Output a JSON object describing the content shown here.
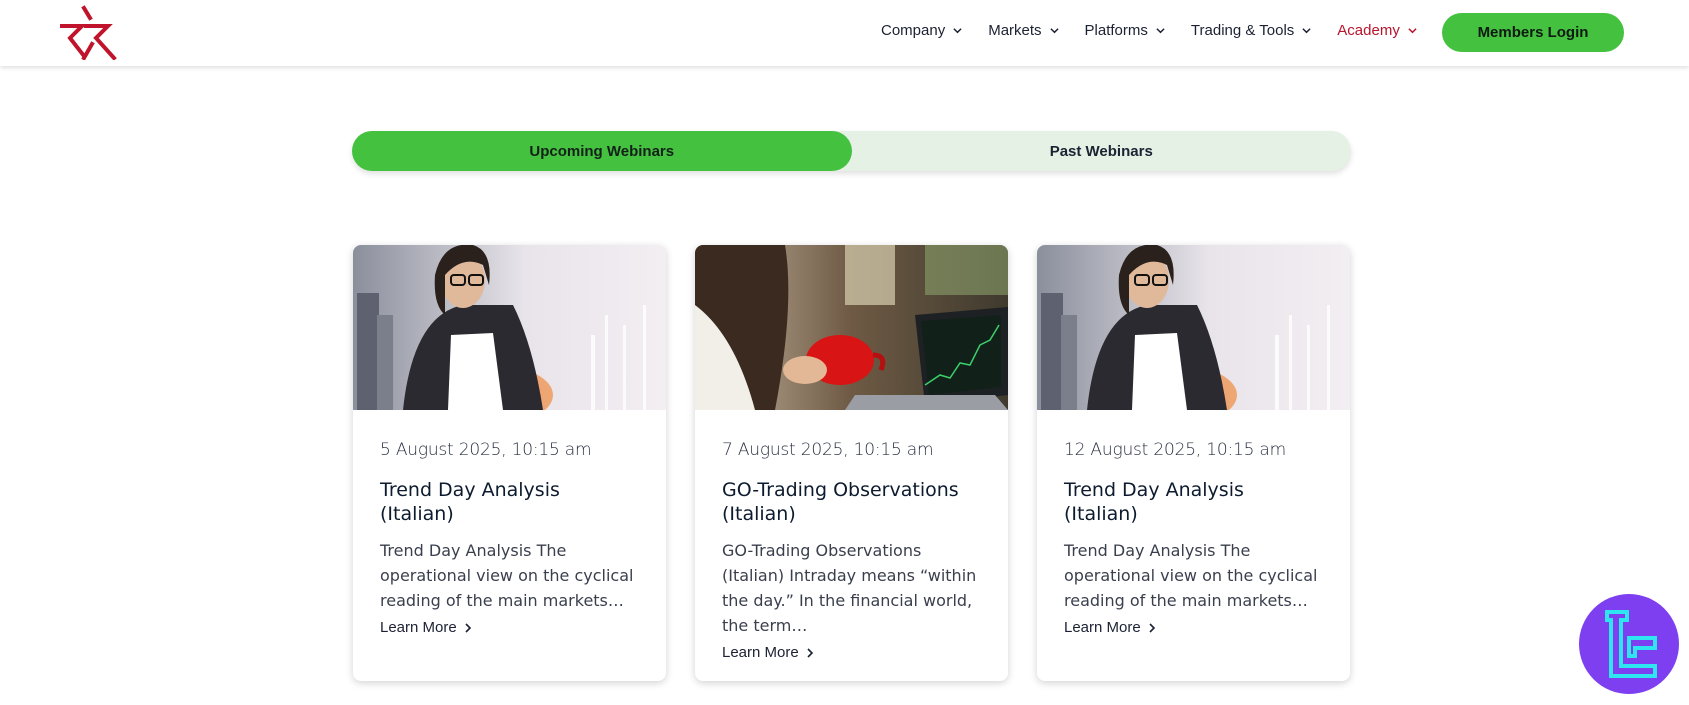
{
  "header": {
    "nav": [
      {
        "label": "Company"
      },
      {
        "label": "Markets"
      },
      {
        "label": "Platforms"
      },
      {
        "label": "Trading & Tools"
      },
      {
        "label": "Academy",
        "active": true
      }
    ],
    "login_label": "Members Login",
    "accent_red": "#b8142c"
  },
  "tabs": [
    {
      "label": "Upcoming Webinars",
      "active": true
    },
    {
      "label": "Past Webinars",
      "active": false
    }
  ],
  "colors": {
    "brand_green": "#44c13f",
    "tab_bg": "#e5f1e4",
    "badge_purple": "#7d3ff0"
  },
  "cards": [
    {
      "image": "woman-with-glasses-city-chart-photo",
      "date": "5 August 2025, 10:15 am",
      "title": "Trend Day Analysis (Italian)",
      "description": "Trend Day Analysis The operational view on the cyclical reading of the main markets…",
      "link": "Learn More"
    },
    {
      "image": "woman-with-coffee-laptop-chart-photo",
      "date": "7 August 2025, 10:15 am",
      "title": "GO-Trading Observations (Italian)",
      "description": "GO-Trading Observations (Italian) Intraday means “within the day.” In the financial world, the term…",
      "link": "Learn More"
    },
    {
      "image": "woman-with-glasses-city-chart-photo",
      "date": "12 August 2025, 10:15 am",
      "title": "Trend Day Analysis (Italian)",
      "description": "Trend Day Analysis The operational view on the cyclical reading of the main markets…",
      "link": "Learn More"
    }
  ]
}
